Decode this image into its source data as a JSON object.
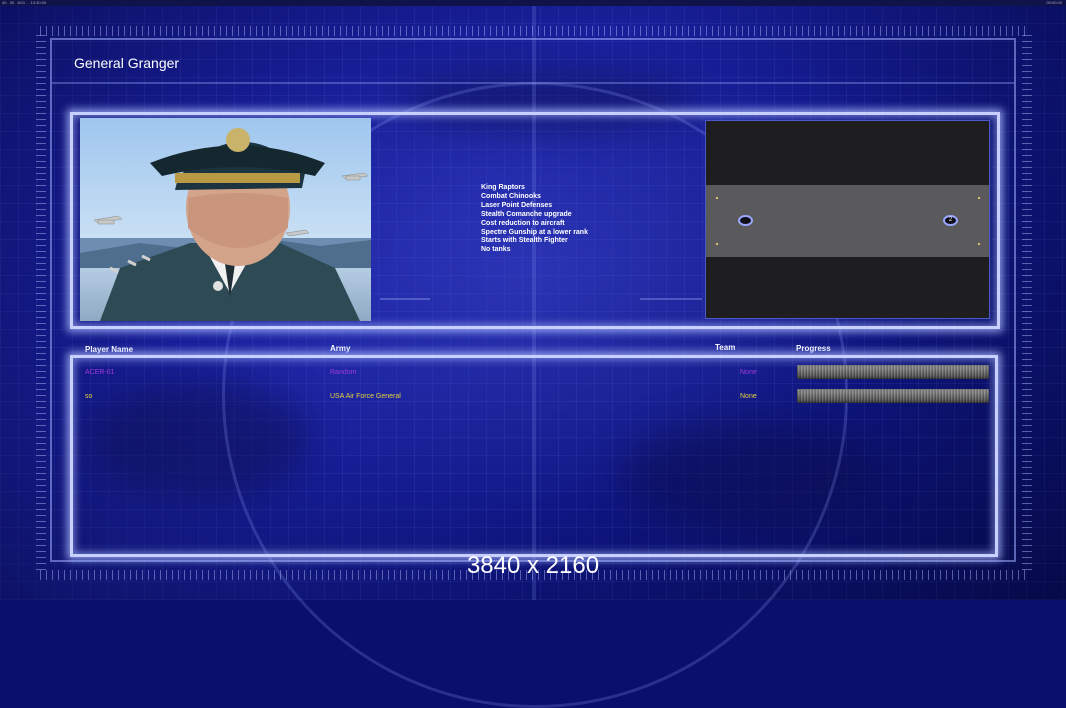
{
  "window": {
    "top_left_text": "40 . 30 . 6/11 . . 13:30:00",
    "top_right_text": "00:00:00"
  },
  "title": "General Granger",
  "general_features": [
    "King Raptors",
    "Combat Chinooks",
    "Laser Point Defenses",
    "Stealth Comanche upgrade",
    "Cost reduction to aircraft",
    "Spectre Gunship at a lower rank",
    "Starts with Stealth Fighter",
    "No tanks"
  ],
  "map": {
    "slots": [
      {
        "label": ""
      },
      {
        "label": "2"
      }
    ]
  },
  "table": {
    "headers": {
      "player_name": "Player Name",
      "army": "Army",
      "team": "Team",
      "progress": "Progress"
    },
    "rows": [
      {
        "player": "ACER-01",
        "army": "Random",
        "team": "None",
        "progress": 1.0,
        "color": "#a23ad8"
      },
      {
        "player": "so",
        "army": "USA Air Force General",
        "team": "None",
        "progress": 1.0,
        "color": "#e8d23a"
      }
    ]
  },
  "resolution_label": "3840 x 2160",
  "colors": {
    "background": "#1a22a6",
    "panel_border": "#c8d0ff",
    "player1": "#a23ad8",
    "player2": "#e8d23a"
  }
}
